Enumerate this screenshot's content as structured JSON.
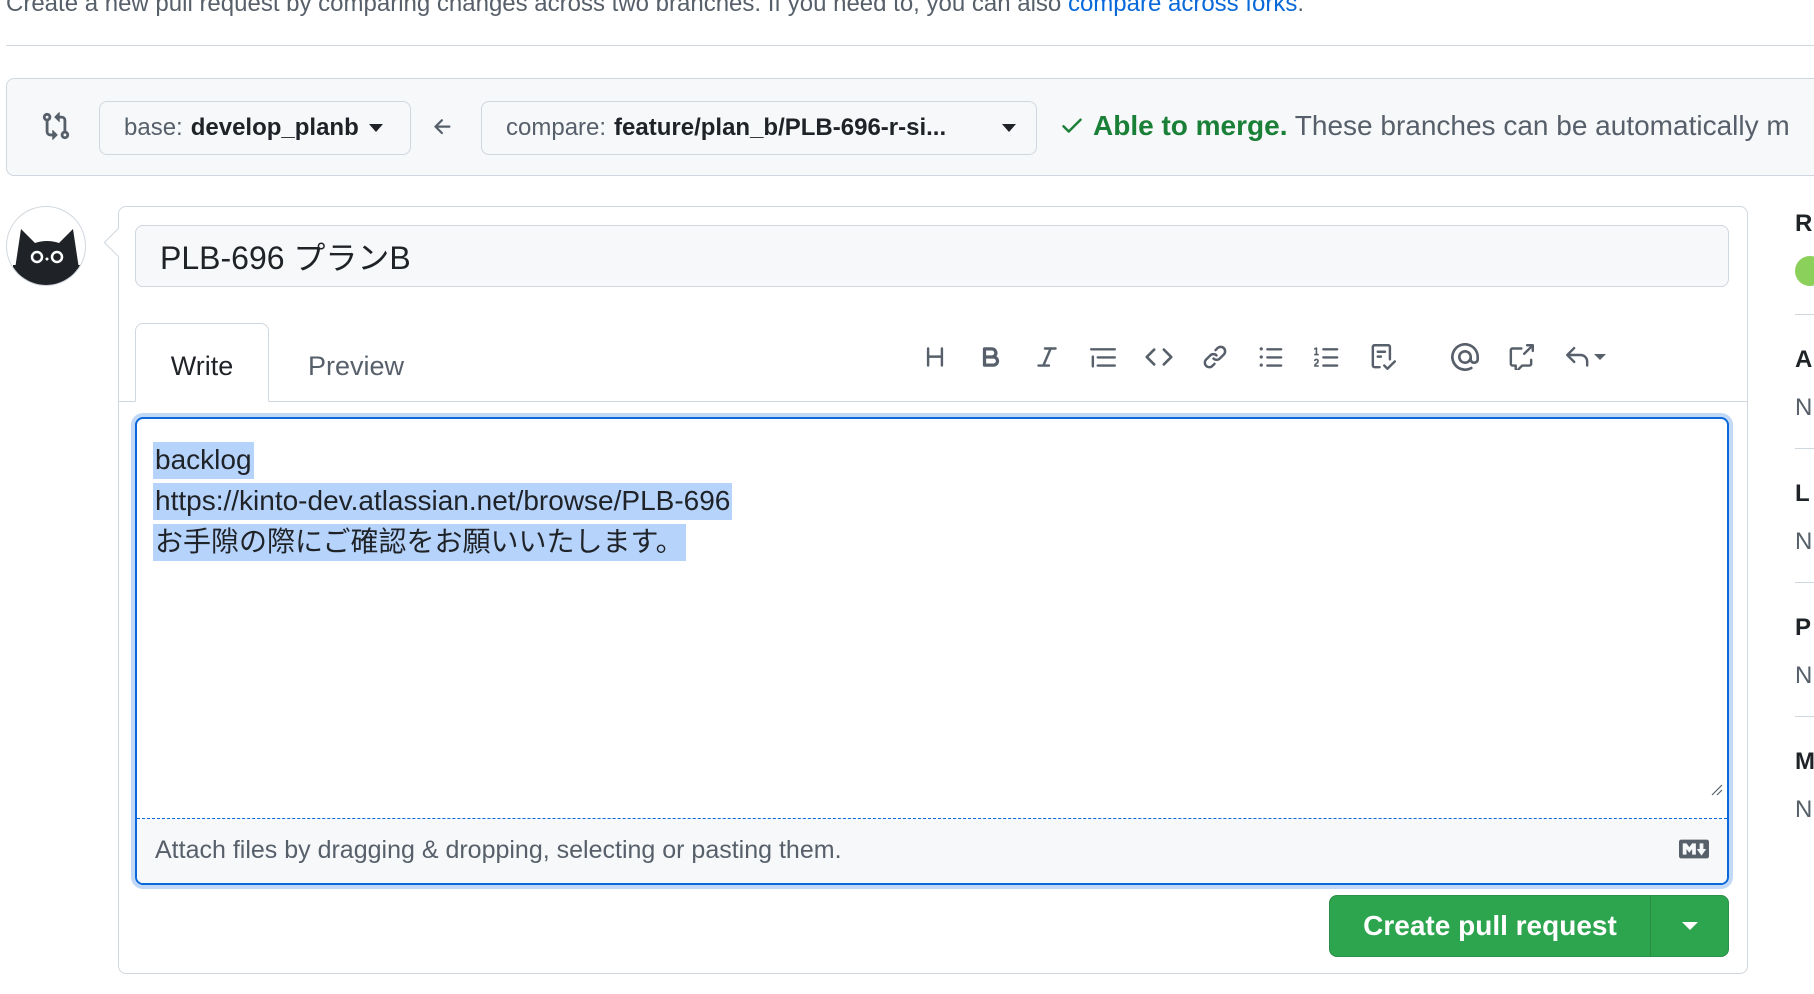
{
  "intro": {
    "text": "Create a new pull request by comparing changes across two branches. If you need to, you can also ",
    "link": "compare across forks",
    "end": "."
  },
  "range": {
    "base_prefix": "base:",
    "base_branch": "develop_planb",
    "compare_prefix": "compare:",
    "compare_branch": "feature/plan_b/PLB-696-r-si...",
    "merge_status": "Able to merge.",
    "merge_detail": "These branches can be automatically m"
  },
  "pr": {
    "title": "PLB-696 プランB",
    "tabs": [
      "Write",
      "Preview"
    ],
    "body_lines": [
      "backlog",
      "https://kinto-dev.atlassian.net/browse/PLB-696",
      "お手隙の際にご確認をお願いいたします。"
    ],
    "attach_hint": "Attach files by dragging & dropping, selecting or pasting them.",
    "create_label": "Create pull request"
  },
  "toolbar_icons": [
    "heading-icon",
    "bold-icon",
    "italic-icon",
    "quote-icon",
    "code-icon",
    "link-icon",
    "unordered-list-icon",
    "ordered-list-icon",
    "task-list-icon",
    "mention-icon",
    "reference-icon",
    "reply-icon"
  ],
  "sidebar": {
    "sections": [
      {
        "head": "R",
        "value": ""
      },
      {
        "head": "A",
        "value": "N"
      },
      {
        "head": "L",
        "value": "N"
      },
      {
        "head": "P",
        "value": "N"
      },
      {
        "head": "M",
        "value": "N"
      }
    ]
  },
  "colors": {
    "accent": "#0969da",
    "success": "#1a7f37",
    "button": "#2da44e",
    "selection": "#b6d3fb"
  }
}
